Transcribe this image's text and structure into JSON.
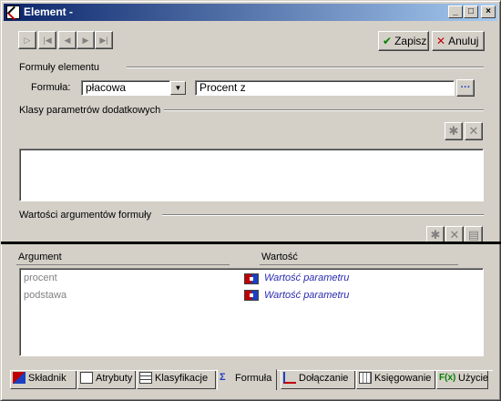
{
  "window": {
    "title": "Element -",
    "controls": {
      "minimize": "_",
      "maximize": "□",
      "close": "×"
    }
  },
  "toolbar": {
    "nav": [
      "first",
      "first-record",
      "previous",
      "next",
      "last"
    ],
    "save_label": "Zapisz",
    "cancel_label": "Anuluj"
  },
  "formula_section": {
    "heading": "Formuły elementu",
    "formula_label": "Formuła:",
    "formula_value": "płacowa",
    "formula_text": "Procent z",
    "ellipsis_label": "···"
  },
  "params_section": {
    "heading": "Klasy parametrów dodatkowych"
  },
  "args_section": {
    "heading": "Wartości argumentów formuły",
    "columns": [
      "Argument",
      "Wartość"
    ],
    "rows": [
      {
        "argument": "procent",
        "value": "Wartość parametru"
      },
      {
        "argument": "podstawa",
        "value": "Wartość parametru"
      }
    ]
  },
  "tabs": [
    {
      "label": "Składnik",
      "icon": "skladnik-icon",
      "active": false
    },
    {
      "label": "Atrybuty",
      "icon": "atrybuty-icon",
      "active": false
    },
    {
      "label": "Klasyfikacje",
      "icon": "klasyfikacje-icon",
      "active": false
    },
    {
      "label": "Formuła",
      "icon": "formula-icon",
      "active": true
    },
    {
      "label": "Dołączanie",
      "icon": "dolaczanie-icon",
      "active": false
    },
    {
      "label": "Księgowanie",
      "icon": "ksiegowanie-icon",
      "active": false
    },
    {
      "label": "Użycie",
      "icon": "uzycie-icon",
      "active": false
    }
  ],
  "colors": {
    "title_bar": "#0a246a",
    "save_check": "#008000",
    "cancel_x": "#c00000",
    "param_value_text": "#2a2ab0"
  }
}
